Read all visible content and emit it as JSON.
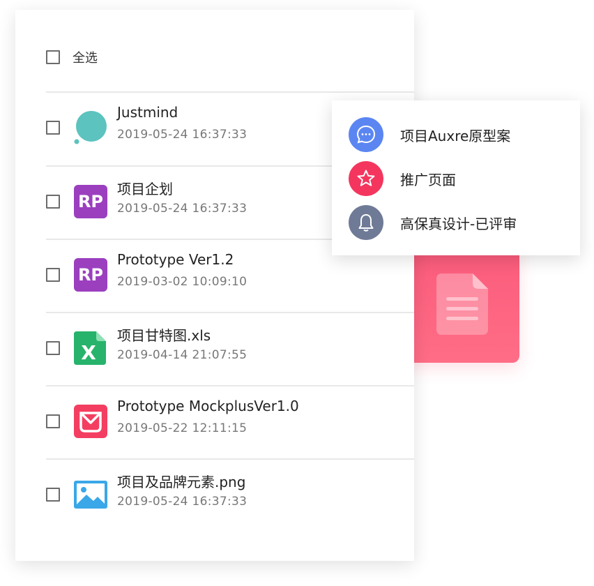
{
  "select_all": {
    "label": "全选"
  },
  "files": [
    {
      "name": "Justmind",
      "time": "2019-05-24 16:37:33",
      "icon": "justmind-logo-icon"
    },
    {
      "name": "项目企划",
      "time": "2019-05-24 16:37:33",
      "icon": "rp-file-icon",
      "badge": "RP"
    },
    {
      "name": "Prototype Ver1.2",
      "time": "2019-03-02 10:09:10",
      "icon": "rp-file-icon",
      "badge": "RP"
    },
    {
      "name": "项目甘特图.xls",
      "time": "2019-04-14 21:07:55",
      "icon": "excel-file-icon"
    },
    {
      "name": "Prototype MockplusVer1.0",
      "time": "2019-05-22 12:11:15",
      "icon": "mockplus-file-icon"
    },
    {
      "name": "项目及品牌元素.png",
      "time": "2019-05-24 16:37:33",
      "icon": "image-file-icon"
    }
  ],
  "popup_menu": {
    "items": [
      {
        "label": "项目Auxre原型案",
        "icon": "chat-bubble-icon",
        "color": "#5b86f2"
      },
      {
        "label": "推广页面",
        "icon": "star-icon",
        "color": "#f4365e"
      },
      {
        "label": "高保真设计-已评审",
        "icon": "bell-icon",
        "color": "#6f7b96"
      }
    ]
  },
  "colors": {
    "justmind": "#5cc3bf",
    "rp": "#9b3fbf",
    "excel": "#27b36b",
    "mockplus": "#f43e61",
    "image": "#3aa7e8",
    "doc_card": "#fb5b7b"
  }
}
